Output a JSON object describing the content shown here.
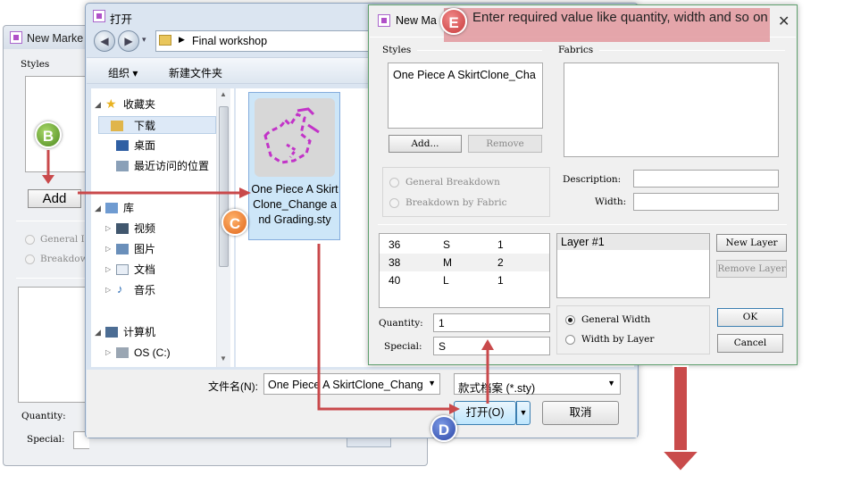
{
  "back_window": {
    "title": "New Marke",
    "styles_label": "Styles",
    "add_button": "Add",
    "radio_general": "General I",
    "radio_breakdown": "Breakdow",
    "quantity_label": "Quantity:",
    "special_label": "Special:"
  },
  "open_dialog": {
    "title": "打开",
    "breadcrumb": "Final workshop",
    "toolbar": {
      "organize": "组织 ▾",
      "new_folder": "新建文件夹"
    },
    "nav": {
      "favorites": "收藏夹",
      "downloads": "下载",
      "desktop": "桌面",
      "recent": "最近访问的位置",
      "libraries": "库",
      "videos": "视频",
      "pictures": "图片",
      "documents": "文档",
      "music": "音乐",
      "computer": "计算机",
      "os_drive": "OS (C:)"
    },
    "file": {
      "name": "One Piece A SkirtClone_Change and Grading.sty"
    },
    "filename_label": "文件名(N):",
    "filename_value": "One Piece A SkirtClone_Chang",
    "filetype_value": "款式档案 (*.sty)",
    "open_button": "打开(O)",
    "cancel_button": "取消"
  },
  "front_window": {
    "title": "New Ma",
    "styles_label": "Styles",
    "fabrics_label": "Fabrics",
    "style_item": "One Piece A SkirtClone_Cha",
    "add_button": "Add...",
    "remove_button": "Remove",
    "radio_general_breakdown": "General Breakdown",
    "radio_breakdown_fabric": "Breakdown by Fabric",
    "description_label": "Description:",
    "width_label": "Width:",
    "sizes": [
      {
        "size": "36",
        "code": "S",
        "qty": "1"
      },
      {
        "size": "38",
        "code": "M",
        "qty": "2"
      },
      {
        "size": "40",
        "code": "L",
        "qty": "1"
      }
    ],
    "layer_item": "Layer #1",
    "new_layer_button": "New Layer",
    "remove_layer_button": "Remove Layer",
    "quantity_label": "Quantity:",
    "quantity_value": "1",
    "special_label": "Special:",
    "special_value": "S",
    "radio_general_width": "General Width",
    "radio_width_layer": "Width by Layer",
    "ok_button": "OK",
    "cancel_button": "Cancel",
    "close_glyph": "✕"
  },
  "annotations": {
    "b": "B",
    "c": "C",
    "d": "D",
    "e": "E",
    "e_text": "Enter required value like quantity, width and so on"
  },
  "colors": {
    "arrow": "#c9494b",
    "selection": "#cce4f7"
  }
}
